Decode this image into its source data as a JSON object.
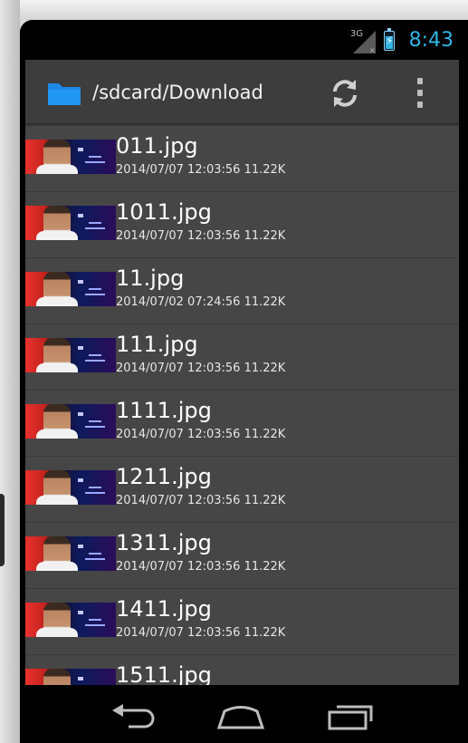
{
  "status": {
    "network": "3G",
    "time": "8:43",
    "accent": "#33b5e5"
  },
  "actionbar": {
    "icon": "folder-icon",
    "path": "/sdcard/Download",
    "refresh_icon": "refresh-icon",
    "overflow_icon": "overflow-menu-icon"
  },
  "files": [
    {
      "name": "011.jpg",
      "meta": "2014/07/07 12:03:56 11.22K"
    },
    {
      "name": "1011.jpg",
      "meta": "2014/07/07 12:03:56 11.22K"
    },
    {
      "name": "11.jpg",
      "meta": "2014/07/02 07:24:56 11.22K"
    },
    {
      "name": "111.jpg",
      "meta": "2014/07/07 12:03:56 11.22K"
    },
    {
      "name": "1111.jpg",
      "meta": "2014/07/07 12:03:56 11.22K"
    },
    {
      "name": "1211.jpg",
      "meta": "2014/07/07 12:03:56 11.22K"
    },
    {
      "name": "1311.jpg",
      "meta": "2014/07/07 12:03:56 11.22K"
    },
    {
      "name": "1411.jpg",
      "meta": "2014/07/07 12:03:56 11.22K"
    },
    {
      "name": "1511.jpg",
      "meta": ""
    }
  ],
  "navbar": {
    "back_icon": "back-icon",
    "home_icon": "home-icon",
    "recent_icon": "recent-apps-icon"
  }
}
